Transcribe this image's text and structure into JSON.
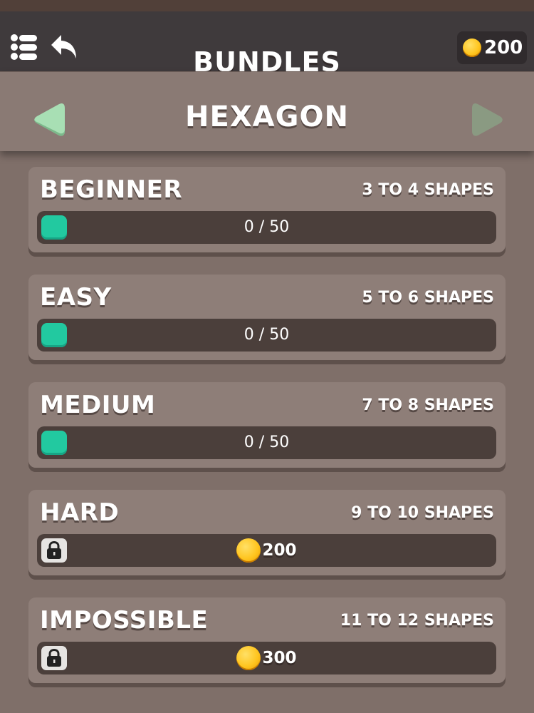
{
  "header": {
    "title": "BUNDLES",
    "coins": "200"
  },
  "bundle": {
    "name": "HEXAGON"
  },
  "levels": [
    {
      "name": "BEGINNER",
      "shapes": "3 TO 4 SHAPES",
      "progress": "0 / 50",
      "locked": false
    },
    {
      "name": "EASY",
      "shapes": "5 TO 6 SHAPES",
      "progress": "0 / 50",
      "locked": false
    },
    {
      "name": "MEDIUM",
      "shapes": "7 TO 8 SHAPES",
      "progress": "0 / 50",
      "locked": false
    },
    {
      "name": "HARD",
      "shapes": "9 TO 10 SHAPES",
      "price": "200",
      "locked": true
    },
    {
      "name": "IMPOSSIBLE",
      "shapes": "11 TO 12 SHAPES",
      "price": "300",
      "locked": true
    }
  ],
  "colors": {
    "accent_fill": "#22c9a0",
    "arrow_left": "#a8dfb4",
    "arrow_right": "#8a9a82",
    "coin": "#ffc51f"
  },
  "icons": [
    "menu-icon",
    "back-arrow-icon",
    "coin-icon",
    "prev-arrow-icon",
    "next-arrow-icon",
    "lock-icon"
  ]
}
